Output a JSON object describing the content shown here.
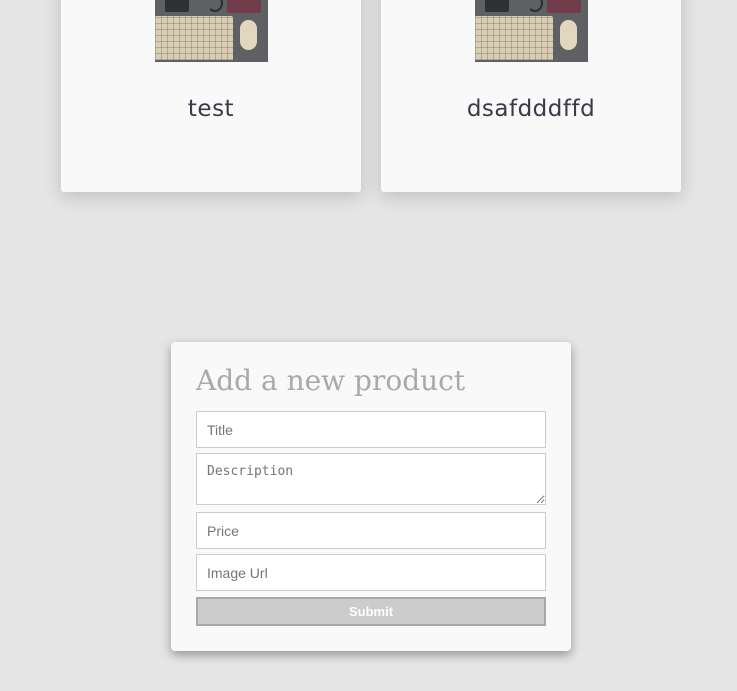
{
  "products": [
    {
      "title": "test",
      "image": "desk-keyboard-photo"
    },
    {
      "title": "dsafdddffd",
      "image": "desk-keyboard-photo"
    }
  ],
  "form": {
    "heading": "Add a new product",
    "title_placeholder": "Title",
    "description_placeholder": "Description",
    "price_placeholder": "Price",
    "image_url_placeholder": "Image Url",
    "submit_label": "Submit"
  },
  "colors": {
    "page_background": "#e5e5e5",
    "card_background": "#f9f9f9",
    "submit_background": "#cccccc",
    "heading_color": "#a9a9a9"
  }
}
